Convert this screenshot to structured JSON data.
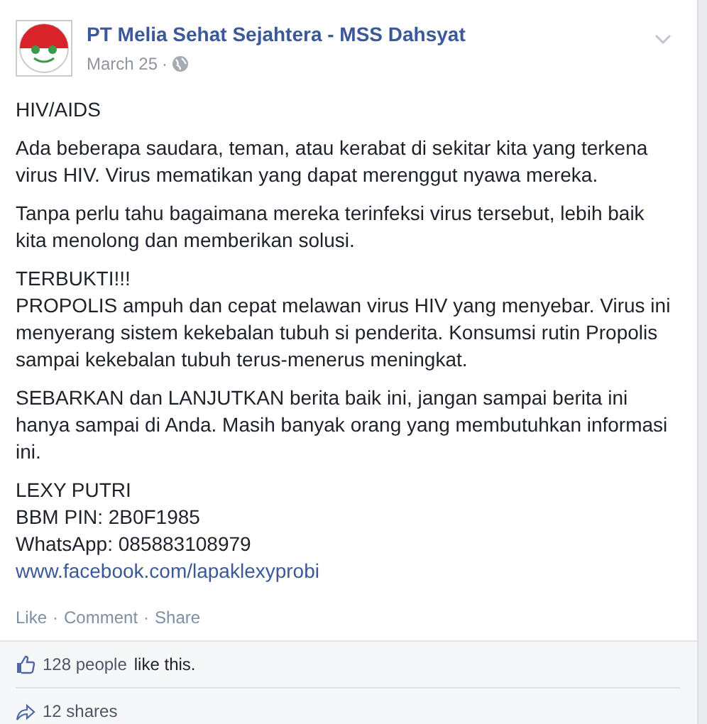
{
  "post": {
    "author": "PT Melia Sehat Sejahtera - MSS Dahsyat",
    "date": "March 25",
    "separator": "·",
    "blocks": [
      [
        {
          "kind": "text",
          "text": "HIV/AIDS"
        }
      ],
      [
        {
          "kind": "text",
          "text": "Ada beberapa saudara, teman, atau kerabat di sekitar kita yang terkena virus HIV. Virus mematikan yang dapat merenggut nyawa mereka."
        }
      ],
      [
        {
          "kind": "text",
          "text": "Tanpa perlu tahu bagaimana mereka terinfeksi virus tersebut, lebih baik kita menolong dan memberikan solusi."
        }
      ],
      [
        {
          "kind": "text",
          "text": "TERBUKTI!!!"
        },
        {
          "kind": "text",
          "text": "PROPOLIS ampuh dan cepat melawan virus HIV yang menyebar. Virus ini menyerang sistem kekebalan tubuh si penderita. Konsumsi rutin Propolis sampai kekebalan tubuh terus-menerus meningkat."
        }
      ],
      [
        {
          "kind": "text",
          "text": "SEBARKAN dan LANJUTKAN berita baik ini, jangan sampai berita ini hanya sampai di Anda. Masih banyak orang yang membutuhkan informasi ini."
        }
      ],
      [
        {
          "kind": "text",
          "text": "LEXY PUTRI"
        },
        {
          "kind": "text",
          "text": "BBM PIN: 2B0F1985"
        },
        {
          "kind": "text",
          "text": "WhatsApp: 085883108979"
        },
        {
          "kind": "link",
          "text": "www.facebook.com/lapaklexyprobi"
        }
      ]
    ],
    "actions": [
      {
        "label": "Like"
      },
      {
        "label": "Comment"
      },
      {
        "label": "Share"
      }
    ]
  },
  "likes": {
    "people": "128 people",
    "text": "like this."
  },
  "shares": "12 shares"
}
